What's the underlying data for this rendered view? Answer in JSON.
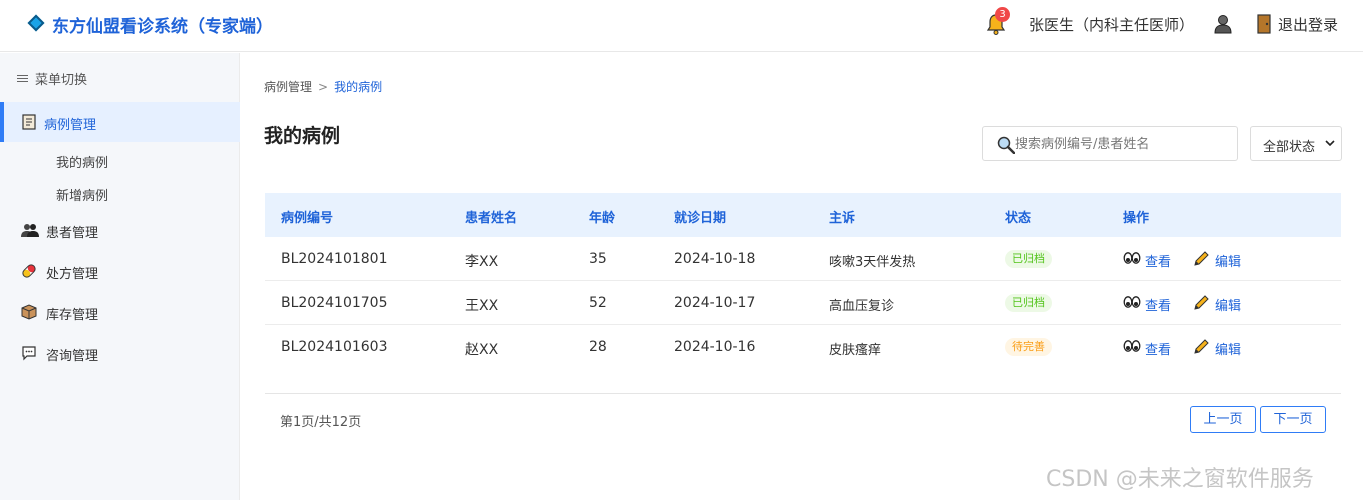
{
  "header": {
    "title": "东方仙盟看诊系统（专家端）",
    "notification_count": "3",
    "user_name": "张医生（内科主任医师）",
    "logout_label": "退出登录"
  },
  "sidebar": {
    "toggle_label": "菜单切换",
    "items": [
      {
        "label": "病例管理",
        "icon": "medical-record-icon"
      },
      {
        "label": "患者管理",
        "icon": "patients-icon"
      },
      {
        "label": "处方管理",
        "icon": "pill-icon"
      },
      {
        "label": "库存管理",
        "icon": "box-icon"
      },
      {
        "label": "咨询管理",
        "icon": "chat-icon"
      }
    ],
    "subitems": [
      {
        "label": "我的病例"
      },
      {
        "label": "新增病例"
      }
    ]
  },
  "breadcrumb": {
    "parent": "病例管理",
    "separator": ">",
    "current": "我的病例"
  },
  "page_title": "我的病例",
  "search": {
    "placeholder": "搜索病例编号/患者姓名",
    "value": ""
  },
  "status_filter": {
    "selected": "全部状态"
  },
  "table": {
    "headers": [
      "病例编号",
      "患者姓名",
      "年龄",
      "就诊日期",
      "主诉",
      "状态",
      "操作"
    ],
    "rows": [
      {
        "id": "BL2024101801",
        "name": "李XX",
        "age": "35",
        "date": "2024-10-18",
        "complaint": "咳嗽3天伴发热",
        "status": "已归档",
        "status_color": "#52c41a",
        "status_bg": "#edf9e6"
      },
      {
        "id": "BL2024101705",
        "name": "王XX",
        "age": "52",
        "date": "2024-10-17",
        "complaint": "高血压复诊",
        "status": "已归档",
        "status_color": "#52c41a",
        "status_bg": "#edf9e6"
      },
      {
        "id": "BL2024101603",
        "name": "赵XX",
        "age": "28",
        "date": "2024-10-16",
        "complaint": "皮肤瘙痒",
        "status": "待完善",
        "status_color": "#fa9d14",
        "status_bg": "#fff5e3"
      }
    ],
    "actions": {
      "view": "查看",
      "edit": "编辑"
    }
  },
  "pagination": {
    "info": "第1页/共12页",
    "prev": "上一页",
    "next": "下一页"
  },
  "watermark": "CSDN @未来之窗软件服务",
  "colors": {
    "primary": "#1f63d8",
    "accent": "#2f7cf6",
    "header_row_bg": "#e8f2fe",
    "sidebar_bg": "#f5f7fa",
    "active_item_bg": "#e6f0ff"
  }
}
